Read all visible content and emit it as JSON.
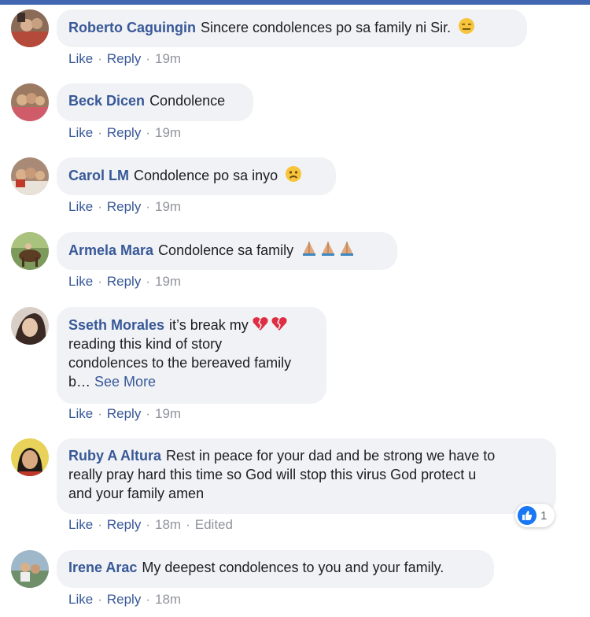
{
  "colors": {
    "accent": "#385898",
    "bubble": "#f0f2f5",
    "meta": "#90949c",
    "top_bar": "#4267b2"
  },
  "actions": {
    "like": "Like",
    "reply": "Reply",
    "separator": "·"
  },
  "comments": [
    {
      "author": "Roberto Caguingin",
      "text_lines": [
        "Sincere condolences po sa family ni Sir."
      ],
      "emoji": "expressionless-face",
      "time": "19m"
    },
    {
      "author": "Beck Dicen",
      "text_lines": [
        "Condolence"
      ],
      "time": "19m"
    },
    {
      "author": "Carol LM",
      "text_lines": [
        "Condolence po sa inyo"
      ],
      "emoji": "worried-face",
      "time": "19m"
    },
    {
      "author": "Armela Mara",
      "text_lines": [
        "Condolence sa family"
      ],
      "emoji": "folded-hands x3",
      "time": "19m"
    },
    {
      "author": "Sseth Morales",
      "text_lines": [
        "it’s break my",
        "reading this kind of story",
        "condolences to the bereaved family",
        "b…"
      ],
      "see_more": "See More",
      "emoji": "broken-heart x2",
      "time": "19m"
    },
    {
      "author": "Ruby A Altura",
      "text_lines": [
        "Rest in peace for your dad and be strong we have to",
        "really pray hard this time so God will stop this virus God protect u",
        "and your family amen"
      ],
      "time": "18m",
      "edited": "Edited",
      "reaction_count": "1"
    },
    {
      "author": "Irene Arac",
      "text_lines": [
        "My deepest condolences to you and your family."
      ],
      "time": "18m"
    }
  ]
}
